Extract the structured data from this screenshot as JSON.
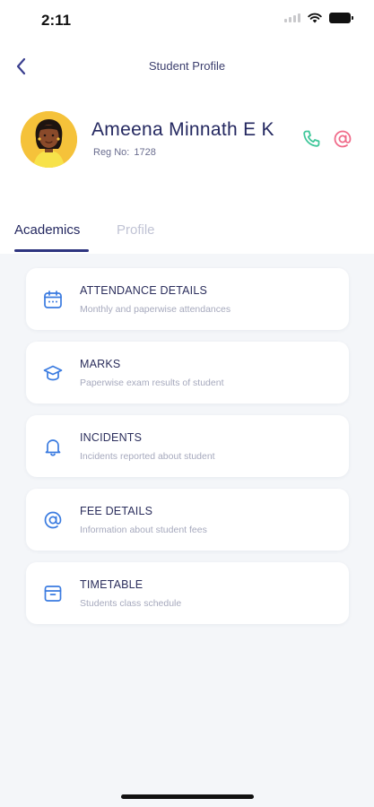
{
  "status_bar": {
    "time": "2:11"
  },
  "nav": {
    "title": "Student Profile"
  },
  "student": {
    "name": "Ameena Minnath E K",
    "reg_label": "Reg No:",
    "reg_no": "1728"
  },
  "tabs": [
    {
      "label": "Academics",
      "active": true
    },
    {
      "label": "Profile",
      "active": false
    }
  ],
  "cards": [
    {
      "icon": "calendar-icon",
      "title": "ATTENDANCE DETAILS",
      "subtitle": "Monthly and paperwise attendances"
    },
    {
      "icon": "graduation-cap-icon",
      "title": "MARKS",
      "subtitle": "Paperwise exam results of student"
    },
    {
      "icon": "bell-icon",
      "title": "INCIDENTS",
      "subtitle": "Incidents reported about student"
    },
    {
      "icon": "at-sign-icon",
      "title": "FEE DETAILS",
      "subtitle": "Information about student fees"
    },
    {
      "icon": "archive-icon",
      "title": "TIMETABLE",
      "subtitle": "Students class schedule"
    }
  ],
  "colors": {
    "accent": "#2f3580",
    "icon_blue": "#3a7be0",
    "phone_green": "#3fc79a",
    "email_pink": "#f06b8a",
    "avatar_yellow": "#f5c23a"
  }
}
